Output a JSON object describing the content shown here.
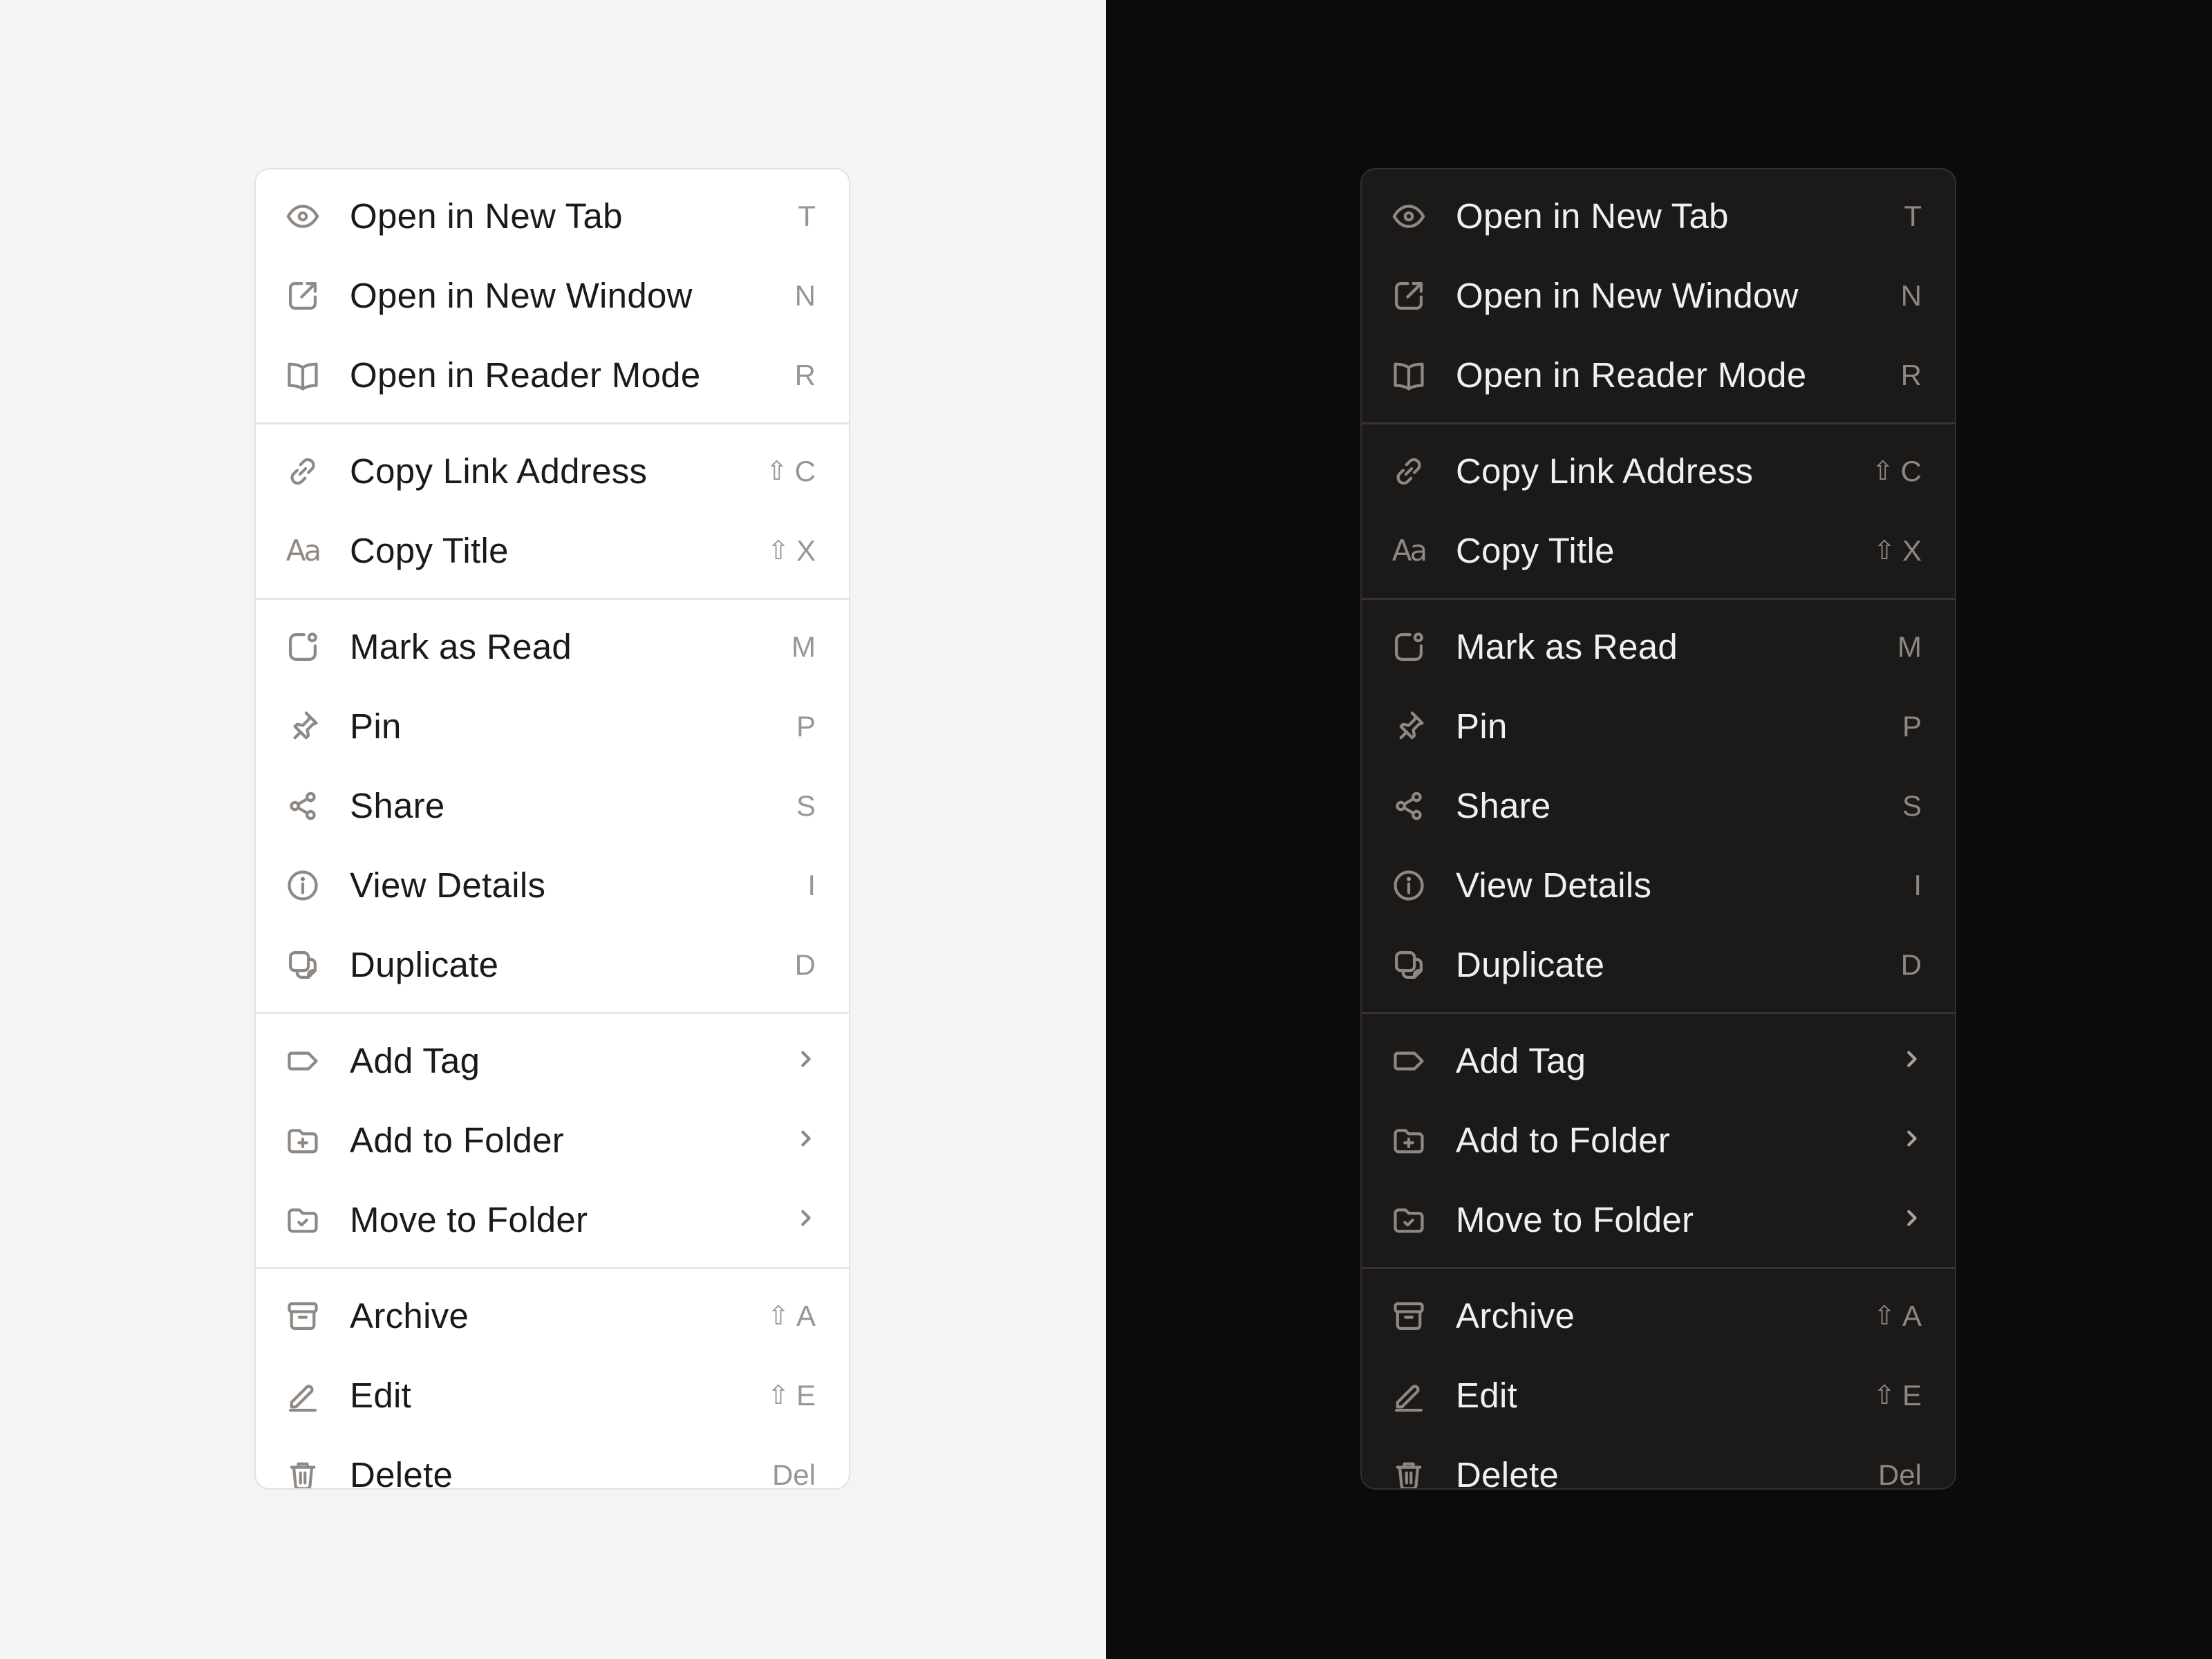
{
  "theme_colors": {
    "light_bg": "#f4f4f4",
    "dark_bg": "#0c0b0a",
    "light_menu": "#ffffff",
    "dark_menu": "#1c1a19"
  },
  "menu": {
    "groups": [
      [
        {
          "icon": "eye-icon",
          "label": "Open in New Tab",
          "shortcut": "T"
        },
        {
          "icon": "external-window-icon",
          "label": "Open in New Window",
          "shortcut": "N"
        },
        {
          "icon": "book-open-icon",
          "label": "Open in Reader Mode",
          "shortcut": "R"
        }
      ],
      [
        {
          "icon": "link-icon",
          "label": "Copy Link Address",
          "shortcut_mod": "⇧",
          "shortcut": "C"
        },
        {
          "icon": "text-aa-icon",
          "label": "Copy Title",
          "shortcut_mod": "⇧",
          "shortcut": "X"
        }
      ],
      [
        {
          "icon": "mark-read-icon",
          "label": "Mark as Read",
          "shortcut": "M"
        },
        {
          "icon": "pin-icon",
          "label": "Pin",
          "shortcut": "P"
        },
        {
          "icon": "share-icon",
          "label": "Share",
          "shortcut": "S"
        },
        {
          "icon": "info-icon",
          "label": "View Details",
          "shortcut": "I"
        },
        {
          "icon": "duplicate-icon",
          "label": "Duplicate",
          "shortcut": "D"
        }
      ],
      [
        {
          "icon": "tag-icon",
          "label": "Add Tag",
          "submenu": true
        },
        {
          "icon": "folder-plus-icon",
          "label": "Add to Folder",
          "submenu": true
        },
        {
          "icon": "folder-check-icon",
          "label": "Move to Folder",
          "submenu": true
        }
      ],
      [
        {
          "icon": "archive-icon",
          "label": "Archive",
          "shortcut_mod": "⇧",
          "shortcut": "A"
        },
        {
          "icon": "pencil-icon",
          "label": "Edit",
          "shortcut_mod": "⇧",
          "shortcut": "E"
        },
        {
          "icon": "trash-icon",
          "label": "Delete",
          "shortcut": "Del"
        }
      ]
    ]
  }
}
